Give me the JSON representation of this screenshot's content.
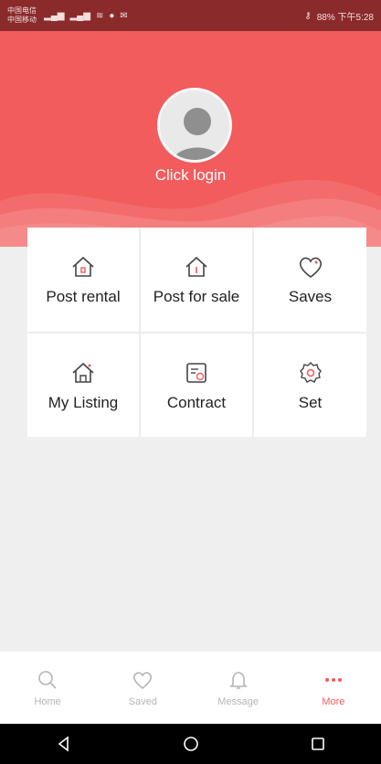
{
  "status_bar": {
    "carrier_line1": "中国电信",
    "carrier_line2": "中国移动",
    "right_text": "88% 下午5:28"
  },
  "profile": {
    "login_label": "Click login"
  },
  "menu": {
    "items": [
      {
        "label": "Post rental",
        "icon": "house-icon"
      },
      {
        "label": "Post for sale",
        "icon": "house-sale-icon"
      },
      {
        "label": "Saves",
        "icon": "heart-icon"
      },
      {
        "label": "My Listing",
        "icon": "house-person-icon"
      },
      {
        "label": "Contract",
        "icon": "contract-icon"
      },
      {
        "label": "Set",
        "icon": "gear-icon"
      }
    ]
  },
  "tab_bar": {
    "tabs": [
      {
        "label": "Home",
        "icon": "search-icon",
        "active": false
      },
      {
        "label": "Saved",
        "icon": "heart-icon",
        "active": false
      },
      {
        "label": "Message",
        "icon": "bell-icon",
        "active": false
      },
      {
        "label": "More",
        "icon": "more-icon",
        "active": true
      }
    ]
  },
  "colors": {
    "accent": "#f25c5c",
    "status_bar": "#8a2a2a",
    "inactive": "#b5b5b5"
  }
}
